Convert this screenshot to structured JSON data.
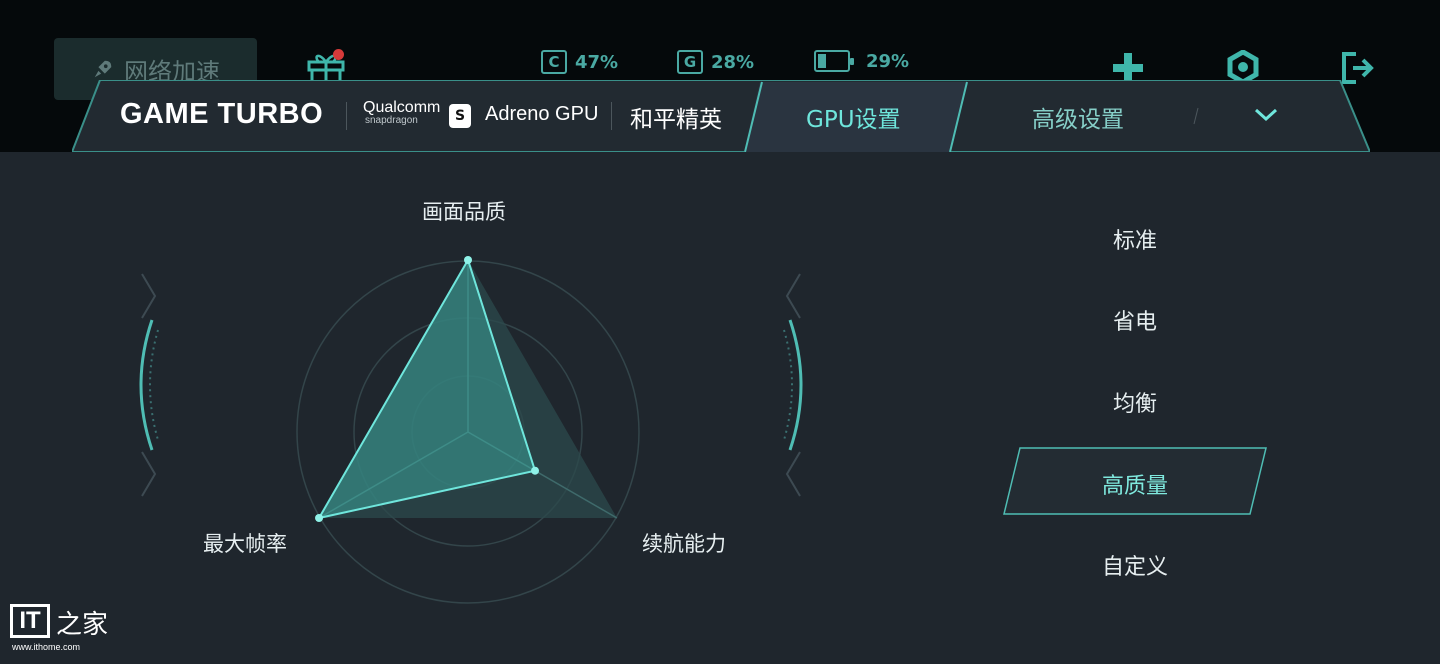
{
  "status": {
    "network_accel_label": "网络加速",
    "cpu": {
      "letter": "C",
      "value": "47%"
    },
    "gpu": {
      "letter": "G",
      "value": "28%"
    },
    "battery": {
      "value": "29%",
      "level": 0.29
    }
  },
  "header": {
    "logo": "GAME TURBO",
    "chip_brand": "Qualcomm",
    "chip_sub": "snapdragon",
    "gpu_name": "Adreno GPU",
    "game_name": "和平精英",
    "tabs": [
      {
        "label": "GPU设置",
        "active": true
      },
      {
        "label": "高级设置",
        "active": false
      }
    ]
  },
  "radar": {
    "axes": [
      "画面品质",
      "最大帧率",
      "续航能力"
    ],
    "values": {
      "画面品质": 1.0,
      "最大帧率": 1.0,
      "续航能力": 0.45
    }
  },
  "presets": {
    "options": [
      "标准",
      "省电",
      "均衡",
      "高质量",
      "自定义"
    ],
    "selected": "高质量"
  },
  "watermark": {
    "it": "IT",
    "zh": "之家",
    "url": "www.ithome.com"
  },
  "colors": {
    "accent": "#6fe6dc",
    "background": "#1f262d",
    "topbar": "#05090b"
  }
}
